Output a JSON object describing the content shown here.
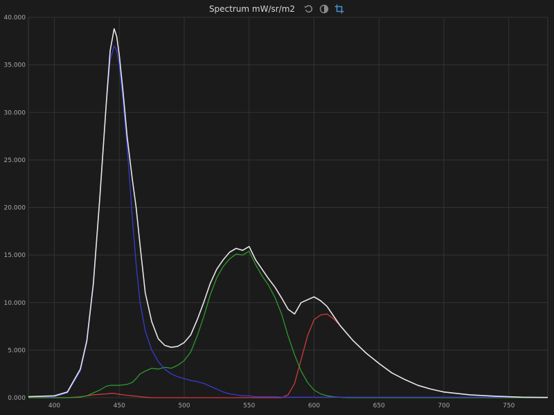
{
  "header": {
    "title": "Spectrum mW/sr/m2",
    "icons": [
      "reset-icon",
      "contrast-icon",
      "crop-icon"
    ]
  },
  "colors": {
    "background": "#1b1b1b",
    "grid": "#333333",
    "axis_text": "#a9a9a9",
    "series_total": "#e8e8e8",
    "series_red": "#d23a3a",
    "series_green": "#2e9a2e",
    "series_blue": "#3a3ad0",
    "icon_active": "#4a8fd6",
    "icon_inactive": "#8a8a8a"
  },
  "chart_data": {
    "type": "line",
    "title": "Spectrum mW/sr/m2",
    "xlabel": "",
    "ylabel": "",
    "xlim": [
      380,
      780
    ],
    "ylim": [
      0,
      40
    ],
    "x_ticks": [
      400,
      450,
      500,
      550,
      600,
      650,
      700,
      750
    ],
    "x_tick_labels": [
      "400",
      "450",
      "500",
      "550",
      "600",
      "650",
      "700",
      "750"
    ],
    "y_ticks": [
      0,
      5,
      10,
      15,
      20,
      25,
      30,
      35,
      40
    ],
    "y_tick_labels": [
      "0.000",
      "5.000",
      "10.000",
      "15.000",
      "20.000",
      "25.000",
      "30.000",
      "35.000",
      "40.000"
    ],
    "grid": true,
    "legend": "none",
    "x": [
      380,
      400,
      410,
      420,
      425,
      430,
      435,
      440,
      443,
      446,
      448,
      450,
      453,
      456,
      460,
      463,
      466,
      470,
      475,
      480,
      485,
      490,
      495,
      500,
      505,
      510,
      515,
      520,
      525,
      530,
      535,
      540,
      545,
      550,
      555,
      560,
      565,
      570,
      575,
      580,
      585,
      590,
      595,
      600,
      605,
      610,
      615,
      620,
      625,
      630,
      640,
      650,
      660,
      670,
      680,
      690,
      700,
      720,
      740,
      760,
      780
    ],
    "series": [
      {
        "color_key": "series_total",
        "values": [
          0.1,
          0.2,
          0.6,
          3.0,
          6.0,
          12.0,
          21.0,
          31.0,
          36.5,
          38.8,
          38.0,
          36.0,
          32.0,
          27.5,
          23.0,
          20.0,
          16.0,
          11.0,
          8.0,
          6.2,
          5.5,
          5.3,
          5.4,
          5.8,
          6.6,
          8.2,
          10.0,
          12.0,
          13.5,
          14.5,
          15.3,
          15.7,
          15.5,
          15.9,
          14.5,
          13.5,
          12.5,
          11.6,
          10.5,
          9.3,
          8.8,
          10.0,
          10.3,
          10.6,
          10.2,
          9.6,
          8.6,
          7.6,
          6.8,
          6.0,
          4.7,
          3.6,
          2.6,
          1.9,
          1.3,
          0.9,
          0.6,
          0.3,
          0.15,
          0.05,
          0.02
        ]
      },
      {
        "color_key": "series_blue",
        "values": [
          0.1,
          0.1,
          0.5,
          2.8,
          5.8,
          11.8,
          20.8,
          30.8,
          35.5,
          37.0,
          36.5,
          35.0,
          31.0,
          26.5,
          19.0,
          14.0,
          10.0,
          7.0,
          5.0,
          3.8,
          3.0,
          2.5,
          2.2,
          2.0,
          1.8,
          1.7,
          1.5,
          1.2,
          0.9,
          0.6,
          0.4,
          0.3,
          0.2,
          0.2,
          0.1,
          0.1,
          0.1,
          0.1,
          0.05,
          0.05,
          0.05,
          0.05,
          0.05,
          0.05,
          0.05,
          0.05,
          0.05,
          0.05,
          0.05,
          0.05,
          0.05,
          0.05,
          0.05,
          0.05,
          0.05,
          0.05,
          0.05,
          0.05,
          0.05,
          0.05,
          0.05
        ]
      },
      {
        "color_key": "series_green",
        "values": [
          0.0,
          0.0,
          0.0,
          0.05,
          0.2,
          0.5,
          0.8,
          1.2,
          1.3,
          1.3,
          1.3,
          1.3,
          1.35,
          1.4,
          1.6,
          2.0,
          2.5,
          2.8,
          3.1,
          3.0,
          3.2,
          3.1,
          3.4,
          3.9,
          4.8,
          6.5,
          8.5,
          10.8,
          12.6,
          13.8,
          14.6,
          15.1,
          15.0,
          15.4,
          14.0,
          12.8,
          11.8,
          10.5,
          8.8,
          6.5,
          4.5,
          2.8,
          1.6,
          0.8,
          0.4,
          0.2,
          0.1,
          0.05,
          0.0,
          0.0,
          0.0,
          0.0,
          0.0,
          0.0,
          0.0,
          0.0,
          0.0,
          0.0,
          0.0,
          0.0,
          0.0
        ]
      },
      {
        "color_key": "series_red",
        "values": [
          0.0,
          0.0,
          0.0,
          0.1,
          0.2,
          0.3,
          0.35,
          0.4,
          0.45,
          0.45,
          0.4,
          0.35,
          0.3,
          0.25,
          0.2,
          0.15,
          0.1,
          0.05,
          0.0,
          0.0,
          0.0,
          0.0,
          0.0,
          0.0,
          0.0,
          0.0,
          0.0,
          0.0,
          0.0,
          0.0,
          0.0,
          0.0,
          0.0,
          0.0,
          0.0,
          0.0,
          0.0,
          0.0,
          0.0,
          0.3,
          1.5,
          4.0,
          6.5,
          8.2,
          8.7,
          8.8,
          8.3,
          7.6,
          6.8,
          6.0,
          4.7,
          3.6,
          2.6,
          1.9,
          1.3,
          0.9,
          0.6,
          0.3,
          0.15,
          0.05,
          0.02
        ]
      }
    ]
  }
}
